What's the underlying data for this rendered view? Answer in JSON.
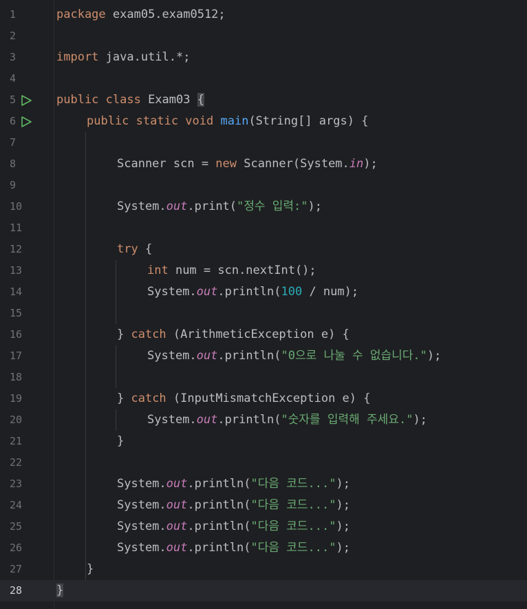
{
  "editor": {
    "lines": [
      {
        "n": "1",
        "indent": 0,
        "tokens": [
          [
            "kw",
            "package"
          ],
          [
            "t",
            " exam05.exam0512;"
          ]
        ]
      },
      {
        "n": "2",
        "indent": 0,
        "tokens": []
      },
      {
        "n": "3",
        "indent": 0,
        "tokens": [
          [
            "kw",
            "import"
          ],
          [
            "t",
            " java.util.*;"
          ]
        ]
      },
      {
        "n": "4",
        "indent": 0,
        "tokens": []
      },
      {
        "n": "5",
        "indent": 0,
        "run": true,
        "tokens": [
          [
            "kw",
            "public class"
          ],
          [
            "t",
            " Exam03 "
          ],
          [
            "hl",
            "{"
          ]
        ]
      },
      {
        "n": "6",
        "indent": 1,
        "run": true,
        "tokens": [
          [
            "kw",
            "public static void"
          ],
          [
            "t",
            " "
          ],
          [
            "fn",
            "main"
          ],
          [
            "t",
            "(String[] args) {"
          ]
        ]
      },
      {
        "n": "7",
        "indent": 0,
        "tokens": []
      },
      {
        "n": "8",
        "indent": 2,
        "tokens": [
          [
            "t",
            "Scanner scn = "
          ],
          [
            "kw",
            "new"
          ],
          [
            "t",
            " Scanner(System."
          ],
          [
            "field",
            "in"
          ],
          [
            "t",
            ");"
          ]
        ]
      },
      {
        "n": "9",
        "indent": 0,
        "tokens": []
      },
      {
        "n": "10",
        "indent": 2,
        "tokens": [
          [
            "t",
            "System."
          ],
          [
            "field",
            "out"
          ],
          [
            "t",
            ".print("
          ],
          [
            "str",
            "\"정수 입력:\""
          ],
          [
            "t",
            ");"
          ]
        ]
      },
      {
        "n": "11",
        "indent": 0,
        "tokens": []
      },
      {
        "n": "12",
        "indent": 2,
        "tokens": [
          [
            "kw",
            "try"
          ],
          [
            "t",
            " {"
          ]
        ]
      },
      {
        "n": "13",
        "indent": 3,
        "tokens": [
          [
            "kw",
            "int"
          ],
          [
            "t",
            " num = scn.nextInt();"
          ]
        ]
      },
      {
        "n": "14",
        "indent": 3,
        "tokens": [
          [
            "t",
            "System."
          ],
          [
            "field",
            "out"
          ],
          [
            "t",
            ".println("
          ],
          [
            "num",
            "100"
          ],
          [
            "t",
            " / num);"
          ]
        ]
      },
      {
        "n": "15",
        "indent": 0,
        "tokens": []
      },
      {
        "n": "16",
        "indent": 2,
        "tokens": [
          [
            "t",
            "} "
          ],
          [
            "kw",
            "catch"
          ],
          [
            "t",
            " (ArithmeticException e) {"
          ]
        ]
      },
      {
        "n": "17",
        "indent": 3,
        "tokens": [
          [
            "t",
            "System."
          ],
          [
            "field",
            "out"
          ],
          [
            "t",
            ".println("
          ],
          [
            "str",
            "\"0으로 나눌 수 없습니다.\""
          ],
          [
            "t",
            ");"
          ]
        ]
      },
      {
        "n": "18",
        "indent": 0,
        "tokens": []
      },
      {
        "n": "19",
        "indent": 2,
        "tokens": [
          [
            "t",
            "} "
          ],
          [
            "kw",
            "catch"
          ],
          [
            "t",
            " (InputMismatchException e) {"
          ]
        ]
      },
      {
        "n": "20",
        "indent": 3,
        "tokens": [
          [
            "t",
            "System."
          ],
          [
            "field",
            "out"
          ],
          [
            "t",
            ".println("
          ],
          [
            "str",
            "\"숫자를 입력해 주세요.\""
          ],
          [
            "t",
            ");"
          ]
        ]
      },
      {
        "n": "21",
        "indent": 2,
        "tokens": [
          [
            "t",
            "}"
          ]
        ]
      },
      {
        "n": "22",
        "indent": 0,
        "tokens": []
      },
      {
        "n": "23",
        "indent": 2,
        "tokens": [
          [
            "t",
            "System."
          ],
          [
            "field",
            "out"
          ],
          [
            "t",
            ".println("
          ],
          [
            "str",
            "\"다음 코드...\""
          ],
          [
            "t",
            ");"
          ]
        ]
      },
      {
        "n": "24",
        "indent": 2,
        "tokens": [
          [
            "t",
            "System."
          ],
          [
            "field",
            "out"
          ],
          [
            "t",
            ".println("
          ],
          [
            "str",
            "\"다음 코드...\""
          ],
          [
            "t",
            ");"
          ]
        ]
      },
      {
        "n": "25",
        "indent": 2,
        "tokens": [
          [
            "t",
            "System."
          ],
          [
            "field",
            "out"
          ],
          [
            "t",
            ".println("
          ],
          [
            "str",
            "\"다음 코드...\""
          ],
          [
            "t",
            ");"
          ]
        ]
      },
      {
        "n": "26",
        "indent": 2,
        "tokens": [
          [
            "t",
            "System."
          ],
          [
            "field",
            "out"
          ],
          [
            "t",
            ".println("
          ],
          [
            "str",
            "\"다음 코드...\""
          ],
          [
            "t",
            ");"
          ]
        ]
      },
      {
        "n": "27",
        "indent": 1,
        "tokens": [
          [
            "t",
            "}"
          ]
        ]
      },
      {
        "n": "28",
        "indent": 0,
        "current": true,
        "tokens": [
          [
            "hl",
            "}"
          ]
        ]
      }
    ]
  },
  "colors": {
    "background": "#1e1f22",
    "keyword": "#cf8e6d",
    "method": "#56a8f5",
    "string": "#6aab73",
    "number": "#2aacb8",
    "static_field": "#c77dbb",
    "run_icon": "#5fb865"
  },
  "icons": {
    "run_gutter": "run-triangle-icon"
  }
}
